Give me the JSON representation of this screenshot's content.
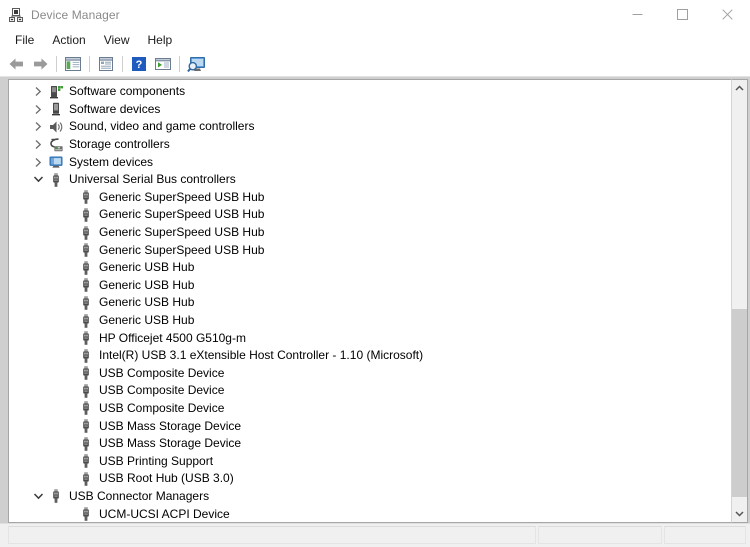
{
  "window": {
    "title": "Device Manager",
    "icon": "device-manager-icon",
    "controls": {
      "minimize": "minimize-icon",
      "maximize": "maximize-icon",
      "close": "close-icon"
    }
  },
  "menubar": {
    "items": [
      {
        "label": "File"
      },
      {
        "label": "Action"
      },
      {
        "label": "View"
      },
      {
        "label": "Help"
      }
    ]
  },
  "toolbar": {
    "buttons": [
      {
        "name": "back-arrow-icon",
        "tooltip": "Back"
      },
      {
        "name": "forward-arrow-icon",
        "tooltip": "Forward"
      },
      {
        "name": "separator-1",
        "tooltip": ""
      },
      {
        "name": "show-hide-console-tree-icon",
        "tooltip": "Show/Hide Console Tree"
      },
      {
        "name": "separator-2",
        "tooltip": ""
      },
      {
        "name": "properties-icon",
        "tooltip": "Properties"
      },
      {
        "name": "separator-3",
        "tooltip": ""
      },
      {
        "name": "help-icon",
        "tooltip": "Help"
      },
      {
        "name": "update-driver-icon",
        "tooltip": "Update Driver Software"
      },
      {
        "name": "separator-4",
        "tooltip": ""
      },
      {
        "name": "scan-for-hardware-changes-icon",
        "tooltip": "Scan for hardware changes"
      }
    ]
  },
  "tree": {
    "rows": [
      {
        "label": "Software components",
        "indent": 1,
        "expander": "collapsed",
        "icon": "software-component-icon"
      },
      {
        "label": "Software devices",
        "indent": 1,
        "expander": "collapsed",
        "icon": "software-device-icon"
      },
      {
        "label": "Sound, video and game controllers",
        "indent": 1,
        "expander": "collapsed",
        "icon": "sound-controller-icon"
      },
      {
        "label": "Storage controllers",
        "indent": 1,
        "expander": "collapsed",
        "icon": "storage-controller-icon"
      },
      {
        "label": "System devices",
        "indent": 1,
        "expander": "collapsed",
        "icon": "system-device-icon"
      },
      {
        "label": "Universal Serial Bus controllers",
        "indent": 1,
        "expander": "expanded",
        "icon": "usb-icon"
      },
      {
        "label": "Generic SuperSpeed USB Hub",
        "indent": 2,
        "expander": "none",
        "icon": "usb-icon"
      },
      {
        "label": "Generic SuperSpeed USB Hub",
        "indent": 2,
        "expander": "none",
        "icon": "usb-icon"
      },
      {
        "label": "Generic SuperSpeed USB Hub",
        "indent": 2,
        "expander": "none",
        "icon": "usb-icon"
      },
      {
        "label": "Generic SuperSpeed USB Hub",
        "indent": 2,
        "expander": "none",
        "icon": "usb-icon"
      },
      {
        "label": "Generic USB Hub",
        "indent": 2,
        "expander": "none",
        "icon": "usb-icon"
      },
      {
        "label": "Generic USB Hub",
        "indent": 2,
        "expander": "none",
        "icon": "usb-icon"
      },
      {
        "label": "Generic USB Hub",
        "indent": 2,
        "expander": "none",
        "icon": "usb-icon"
      },
      {
        "label": "Generic USB Hub",
        "indent": 2,
        "expander": "none",
        "icon": "usb-icon"
      },
      {
        "label": "HP Officejet 4500 G510g-m",
        "indent": 2,
        "expander": "none",
        "icon": "usb-icon"
      },
      {
        "label": "Intel(R) USB 3.1 eXtensible Host Controller - 1.10 (Microsoft)",
        "indent": 2,
        "expander": "none",
        "icon": "usb-icon"
      },
      {
        "label": "USB Composite Device",
        "indent": 2,
        "expander": "none",
        "icon": "usb-icon"
      },
      {
        "label": "USB Composite Device",
        "indent": 2,
        "expander": "none",
        "icon": "usb-icon"
      },
      {
        "label": "USB Composite Device",
        "indent": 2,
        "expander": "none",
        "icon": "usb-icon"
      },
      {
        "label": "USB Mass Storage Device",
        "indent": 2,
        "expander": "none",
        "icon": "usb-icon"
      },
      {
        "label": "USB Mass Storage Device",
        "indent": 2,
        "expander": "none",
        "icon": "usb-icon"
      },
      {
        "label": "USB Printing Support",
        "indent": 2,
        "expander": "none",
        "icon": "usb-icon"
      },
      {
        "label": "USB Root Hub (USB 3.0)",
        "indent": 2,
        "expander": "none",
        "icon": "usb-icon"
      },
      {
        "label": "USB Connector Managers",
        "indent": 1,
        "expander": "expanded",
        "icon": "usb-icon"
      },
      {
        "label": "UCM-UCSI ACPI Device",
        "indent": 2,
        "expander": "none",
        "icon": "usb-icon"
      }
    ]
  },
  "scrollbar": {
    "up_arrow": "chevron-up-icon",
    "down_arrow": "chevron-down-icon",
    "thumb_top_pct": 52,
    "thumb_height_pct": 46
  },
  "statusbar": {
    "panels": [
      {
        "text": ""
      },
      {
        "text": ""
      },
      {
        "text": ""
      }
    ]
  },
  "colors": {
    "titlebar_text": "#8a8a8a",
    "window_bg": "#ffffff",
    "client_bg": "#cfcfcf",
    "statusbar_bg": "#f0f0f0",
    "scroll_thumb": "#cdcdcd",
    "help_blue": "#1f5bbf",
    "accent_green": "#3f9d35"
  }
}
